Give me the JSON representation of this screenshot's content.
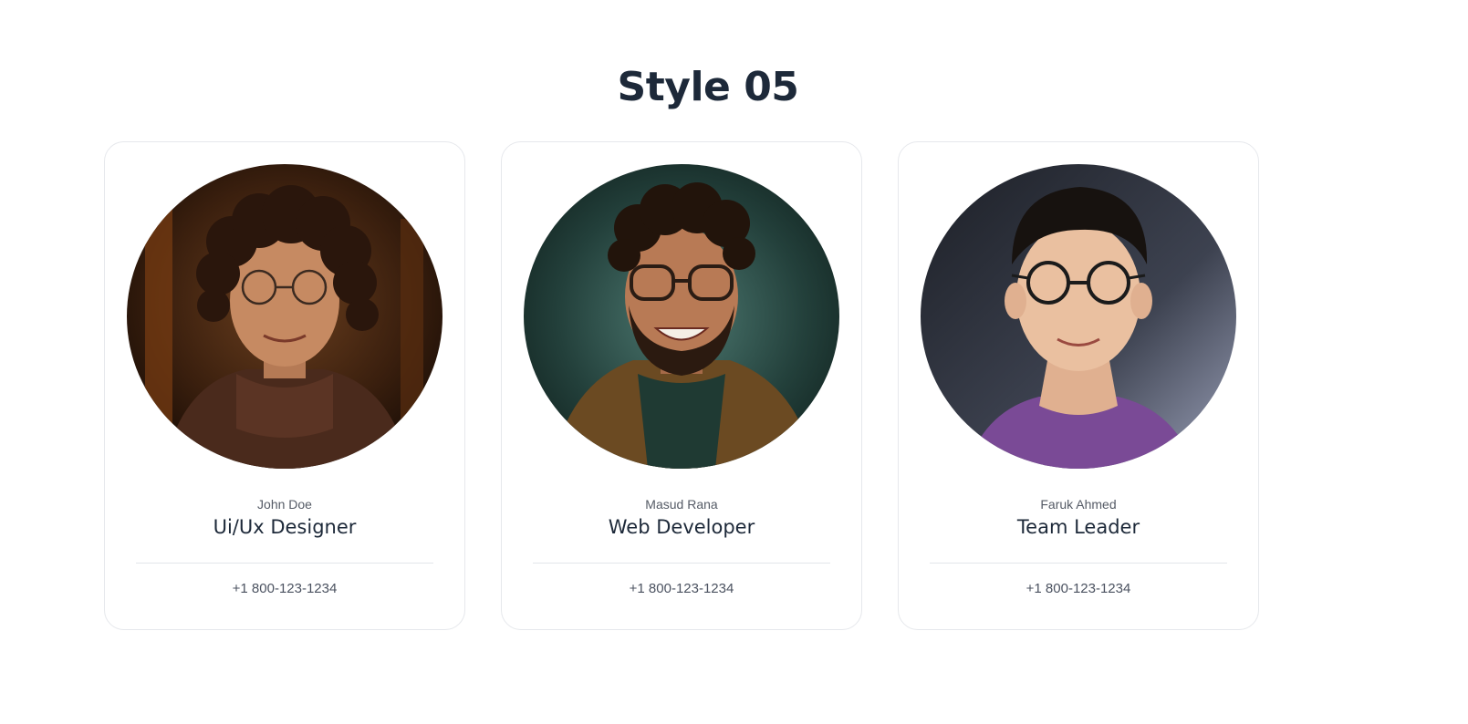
{
  "section": {
    "title": "Style 05"
  },
  "team": [
    {
      "name": "John Doe",
      "role": "Ui/Ux Designer",
      "phone": "+1 800-123-1234",
      "photo": "portrait-curly-hair-glasses"
    },
    {
      "name": "Masud Rana",
      "role": "Web Developer",
      "phone": "+1 800-123-1234",
      "photo": "portrait-smiling-beard-glasses"
    },
    {
      "name": "Faruk Ahmed",
      "role": "Team Leader",
      "phone": "+1 800-123-1234",
      "photo": "portrait-short-hair-glasses"
    }
  ],
  "colors": {
    "title": "#1d2939",
    "card_border": "#e6e8ec",
    "divider": "#e2e5ea",
    "muted_text": "#555b66"
  }
}
